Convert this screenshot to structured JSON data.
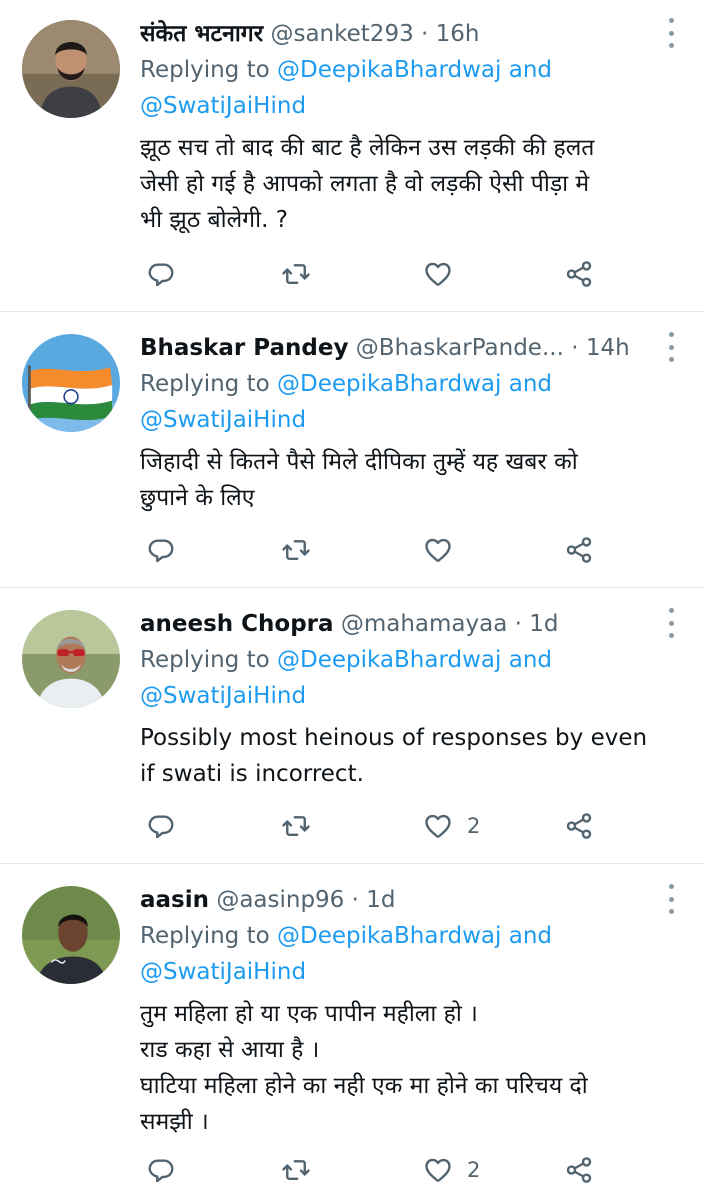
{
  "tweets": [
    {
      "name": "संकेत भटनागर",
      "handle": "@sanket293",
      "time": "16h",
      "replying_prefix": "Replying to",
      "replying_user1": "@DeepikaBhardwaj",
      "replying_and": "and",
      "replying_user2": "@SwatiJaiHind",
      "text": "झूठ सच तो बाद की बाट है लेकिन उस लड़की की हलत\nजेसी हो गई है आपको लगता है वो लड़की ऐसी पीड़ा मे\nभी झूठ बोलेगी. ?",
      "likes": ""
    },
    {
      "name": "Bhaskar Pandey",
      "handle": "@BhaskarPande...",
      "time": "14h",
      "replying_prefix": "Replying to",
      "replying_user1": "@DeepikaBhardwaj",
      "replying_and": "and",
      "replying_user2": "@SwatiJaiHind",
      "text": "जिहादी से कितने पैसे मिले दीपिका तुम्हें यह खबर को\nछुपाने के लिए",
      "likes": ""
    },
    {
      "name": "aneesh Chopra",
      "handle": "@mahamayaa",
      "time": "1d",
      "replying_prefix": "Replying to",
      "replying_user1": "@DeepikaBhardwaj",
      "replying_and": "and",
      "replying_user2": "@SwatiJaiHind",
      "text": "Possibly most heinous of responses by even\nif swati is incorrect.",
      "likes": "2"
    },
    {
      "name": "aasin",
      "handle": "@aasinp96",
      "time": "1d",
      "replying_prefix": "Replying to",
      "replying_user1": "@DeepikaBhardwaj",
      "replying_and": "and",
      "replying_user2": "@SwatiJaiHind",
      "text": "तुम महिला हो या एक पापीन महीला हो ।\nराड कहा से आया है ।\nघाटिया महिला होने का नही एक मा होने का परिचय दो\nसमझी ।",
      "likes": "2"
    }
  ],
  "colors": {
    "link": "#1d9bf0",
    "secondary": "#536471",
    "icon": "#536471",
    "divider": "#e1e8ed"
  },
  "icons": [
    "reply-icon",
    "retweet-icon",
    "like-icon",
    "share-icon",
    "more-icon"
  ]
}
